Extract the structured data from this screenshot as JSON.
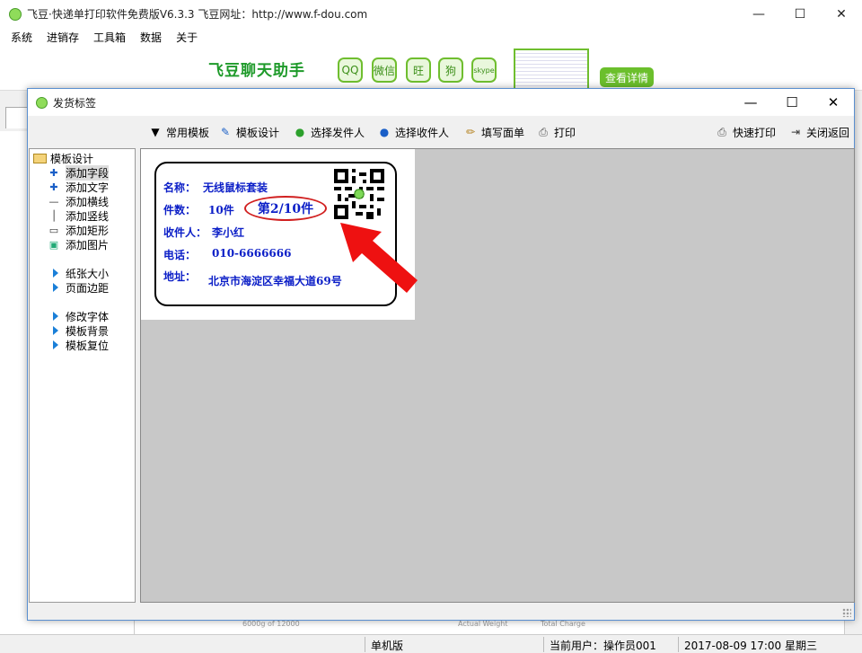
{
  "main_window": {
    "title": "飞豆·快递单打印软件免费版V6.3.3   飞豆网址：http://www.f-dou.com",
    "controls": [
      "—",
      "☐",
      "✕"
    ]
  },
  "menu": [
    "系统",
    "进销存",
    "工具箱",
    "数据",
    "关于"
  ],
  "banner": {
    "title": "飞豆聊天助手",
    "icons": [
      "QQ",
      "微信",
      "旺",
      "狗",
      "skype"
    ],
    "button": "查看详情"
  },
  "background_bottom": [
    "6000g of 12000",
    "Actual Weight",
    "Total Charge"
  ],
  "statusbar": {
    "mode": "单机版",
    "user": "当前用户：操作员001",
    "datetime": "2017-08-09 17:00 星期三"
  },
  "dialog": {
    "title": "发货标签",
    "controls": [
      "—",
      "☐",
      "✕"
    ],
    "toolbar": {
      "template": "常用模板",
      "design": "模板设计",
      "sender": "选择发件人",
      "receiver": "选择收件人",
      "fill": "填写面单",
      "print": "打印",
      "quick_print": "快速打印",
      "close": "关闭返回"
    },
    "tree": {
      "root": "模板设计",
      "items": [
        "添加字段",
        "添加文字",
        "添加横线",
        "添加竖线",
        "添加矩形",
        "添加图片"
      ],
      "page_items": [
        "纸张大小",
        "页面边距"
      ],
      "style_items": [
        "修改字体",
        "模板背景",
        "模板复位"
      ]
    },
    "label": {
      "name_key": "名称：",
      "name_val": "无线鼠标套装",
      "count_key": "件数：",
      "count_val": "10件",
      "piece": "第2/10件",
      "receiver_key": "收件人：",
      "receiver_val": "李小红",
      "phone_key": "电话：",
      "phone_val": "010-6666666",
      "addr_key": "地址：",
      "addr_val": "北京市海淀区幸福大道69号"
    },
    "colors": {
      "label_text": "#0b1ec7",
      "oval": "#d12020",
      "arrow": "#ee1111"
    }
  }
}
